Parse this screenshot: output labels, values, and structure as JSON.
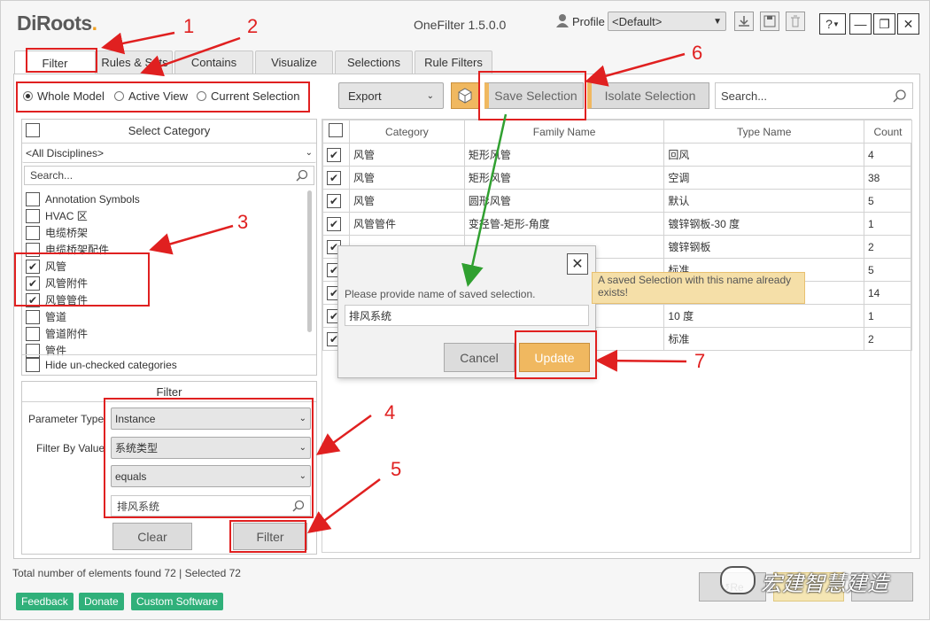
{
  "app": {
    "logo": "DiRoots",
    "title": "OneFilter 1.5.0.0"
  },
  "profile": {
    "label": "Profile",
    "value": "<Default>"
  },
  "help": {
    "label": "?"
  },
  "tabs": [
    {
      "label": "Filter"
    },
    {
      "label": "Rules & Sets"
    },
    {
      "label": "Contains"
    },
    {
      "label": "Visualize"
    },
    {
      "label": "Selections"
    },
    {
      "label": "Rule Filters"
    }
  ],
  "scope": {
    "whole": "Whole Model",
    "active": "Active View",
    "current": "Current Selection"
  },
  "category": {
    "header": "Select Category",
    "discipline": "<All Disciplines>",
    "search_placeholder": "Search...",
    "items": [
      {
        "label": "Annotation Symbols",
        "checked": false
      },
      {
        "label": "HVAC 区",
        "checked": false
      },
      {
        "label": "电缆桥架",
        "checked": false
      },
      {
        "label": "电缆桥架配件",
        "checked": false
      },
      {
        "label": "风管",
        "checked": true
      },
      {
        "label": "风管附件",
        "checked": true
      },
      {
        "label": "风管管件",
        "checked": true
      },
      {
        "label": "管道",
        "checked": false
      },
      {
        "label": "管道附件",
        "checked": false
      },
      {
        "label": "管件",
        "checked": false
      }
    ],
    "hide_label": "Hide un-checked categories"
  },
  "filter": {
    "title": "Filter",
    "param_type_label": "Parameter Type",
    "param_type": "Instance",
    "by_value_label": "Filter By Value",
    "param": "系统类型",
    "operator": "equals",
    "value": "排风系统",
    "clear": "Clear",
    "filter": "Filter"
  },
  "toolbar": {
    "export": "Export",
    "save_selection": "Save Selection",
    "isolate_selection": "Isolate Selection",
    "search_placeholder": "Search..."
  },
  "table": {
    "headers": [
      "Category",
      "Family Name",
      "Type Name",
      "Count"
    ],
    "rows": [
      {
        "category": "风管",
        "family": "矩形风管",
        "type": "回风",
        "count": "4"
      },
      {
        "category": "风管",
        "family": "矩形风管",
        "type": "空调",
        "count": "38"
      },
      {
        "category": "风管",
        "family": "圆形风管",
        "type": "默认",
        "count": "5"
      },
      {
        "category": "风管管件",
        "family": "变径管-矩形-角度",
        "type": "镀锌钢板-30 度",
        "count": "1"
      },
      {
        "category": "",
        "family": "",
        "type": "镀锌钢板",
        "count": "2"
      },
      {
        "category": "",
        "family": "",
        "type": "标准",
        "count": "5"
      },
      {
        "category": "",
        "family": "",
        "type": "",
        "count": "14"
      },
      {
        "category": "",
        "family": "",
        "type": "10 度",
        "count": "1"
      },
      {
        "category": "",
        "family": "",
        "type": "标准",
        "count": "2"
      }
    ]
  },
  "dialog": {
    "prompt": "Please provide name of saved selection.",
    "name_value": "排风系统",
    "cancel": "Cancel",
    "update": "Update",
    "warning": "A saved Selection with this name already exists!"
  },
  "status": {
    "text": "Total number of elements found 72 | Selected 72"
  },
  "footer": {
    "feedback": "Feedback",
    "donate": "Donate",
    "custom": "Custom Software",
    "reset": "Re",
    "watermark": "宏建智慧建造"
  },
  "annotations": [
    "1",
    "2",
    "3",
    "4",
    "5",
    "6",
    "7"
  ]
}
